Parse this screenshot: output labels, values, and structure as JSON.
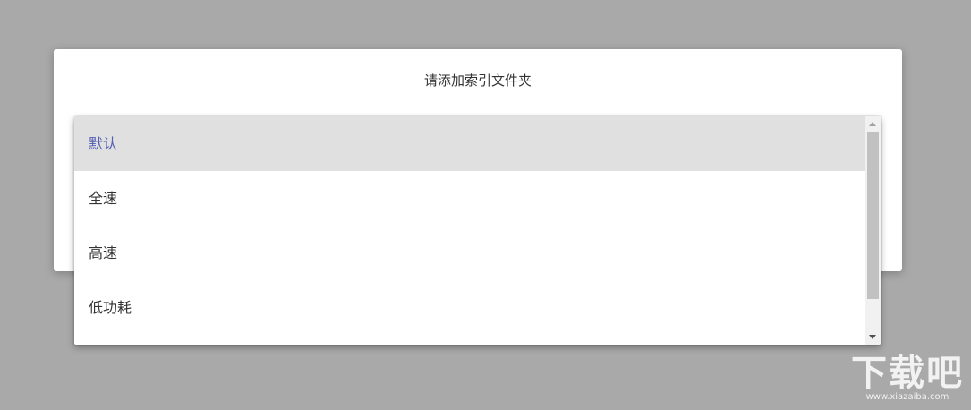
{
  "dialog": {
    "title": "请添加索引文件夹"
  },
  "dropdown": {
    "selected": "默认",
    "options": [
      {
        "label": "默认"
      },
      {
        "label": "全速"
      },
      {
        "label": "高速"
      },
      {
        "label": "低功耗"
      }
    ]
  },
  "watermark": {
    "logo": "下载吧",
    "url": "www.xiazaiba.com"
  },
  "colors": {
    "overlay": "#a9a9a9",
    "selected_bg": "#e0e0e0",
    "selected_text": "#5661b3"
  }
}
